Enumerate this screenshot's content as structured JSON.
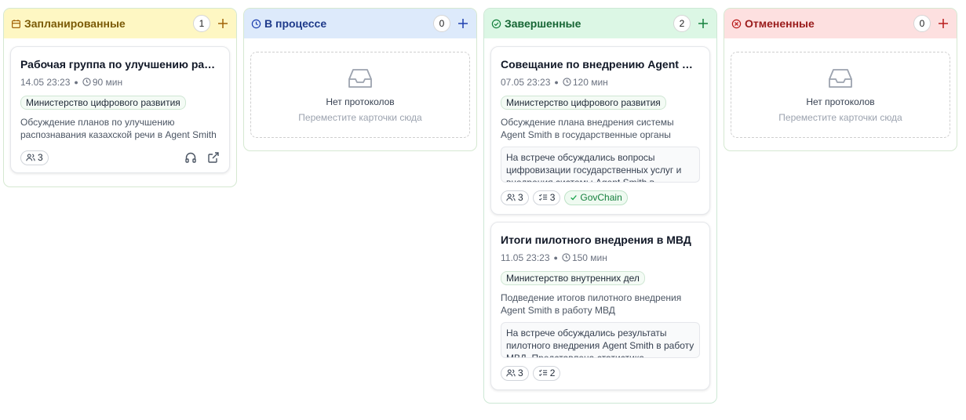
{
  "colors": {
    "planned_header": "#fef7c3",
    "progress_header": "#ddeafb",
    "done_header": "#dcf7e5",
    "cancelled_header": "#fde0e0"
  },
  "columns": {
    "planned": {
      "title": "Запланированные",
      "icon": "calendar-icon",
      "count": "1",
      "cards": [
        {
          "title": "Рабочая группа по улучшению распознавания казахской речи",
          "date": "14.05 23:23",
          "duration": "90 мин",
          "tag": "Министерство цифрового развития",
          "description": "Обсуждение планов по улучшению распознавания казахской речи в Agent Smith",
          "participants": "3"
        }
      ]
    },
    "in_progress": {
      "title": "В процессе",
      "icon": "clock-icon",
      "count": "0",
      "empty_title": "Нет протоколов",
      "empty_hint": "Переместите карточки сюда"
    },
    "done": {
      "title": "Завершенные",
      "icon": "check-circle-icon",
      "count": "2",
      "cards": [
        {
          "title": "Совещание по внедрению Agent Smith",
          "date": "07.05 23:23",
          "duration": "120 мин",
          "tag": "Министерство цифрового развития",
          "description": "Обсуждение плана внедрения системы Agent Smith в государственные органы Казахстана",
          "summary": "На встрече обсуждались вопросы цифровизации государственных услуг и внедрения системы Agent Smith в",
          "participants": "3",
          "tasks": "3",
          "badge": "GovChain"
        },
        {
          "title": "Итоги пилотного внедрения в МВД",
          "date": "11.05 23:23",
          "duration": "150 мин",
          "tag": "Министерство внутренних дел",
          "description": "Подведение итогов пилотного внедрения Agent Smith в работу МВД",
          "summary": "На встрече обсуждались результаты пилотного внедрения Agent Smith в работу МВД. Представлена статистика",
          "participants": "3",
          "tasks": "2"
        }
      ]
    },
    "cancelled": {
      "title": "Отмененные",
      "icon": "x-circle-icon",
      "count": "0",
      "empty_title": "Нет протоколов",
      "empty_hint": "Переместите карточки сюда"
    }
  }
}
